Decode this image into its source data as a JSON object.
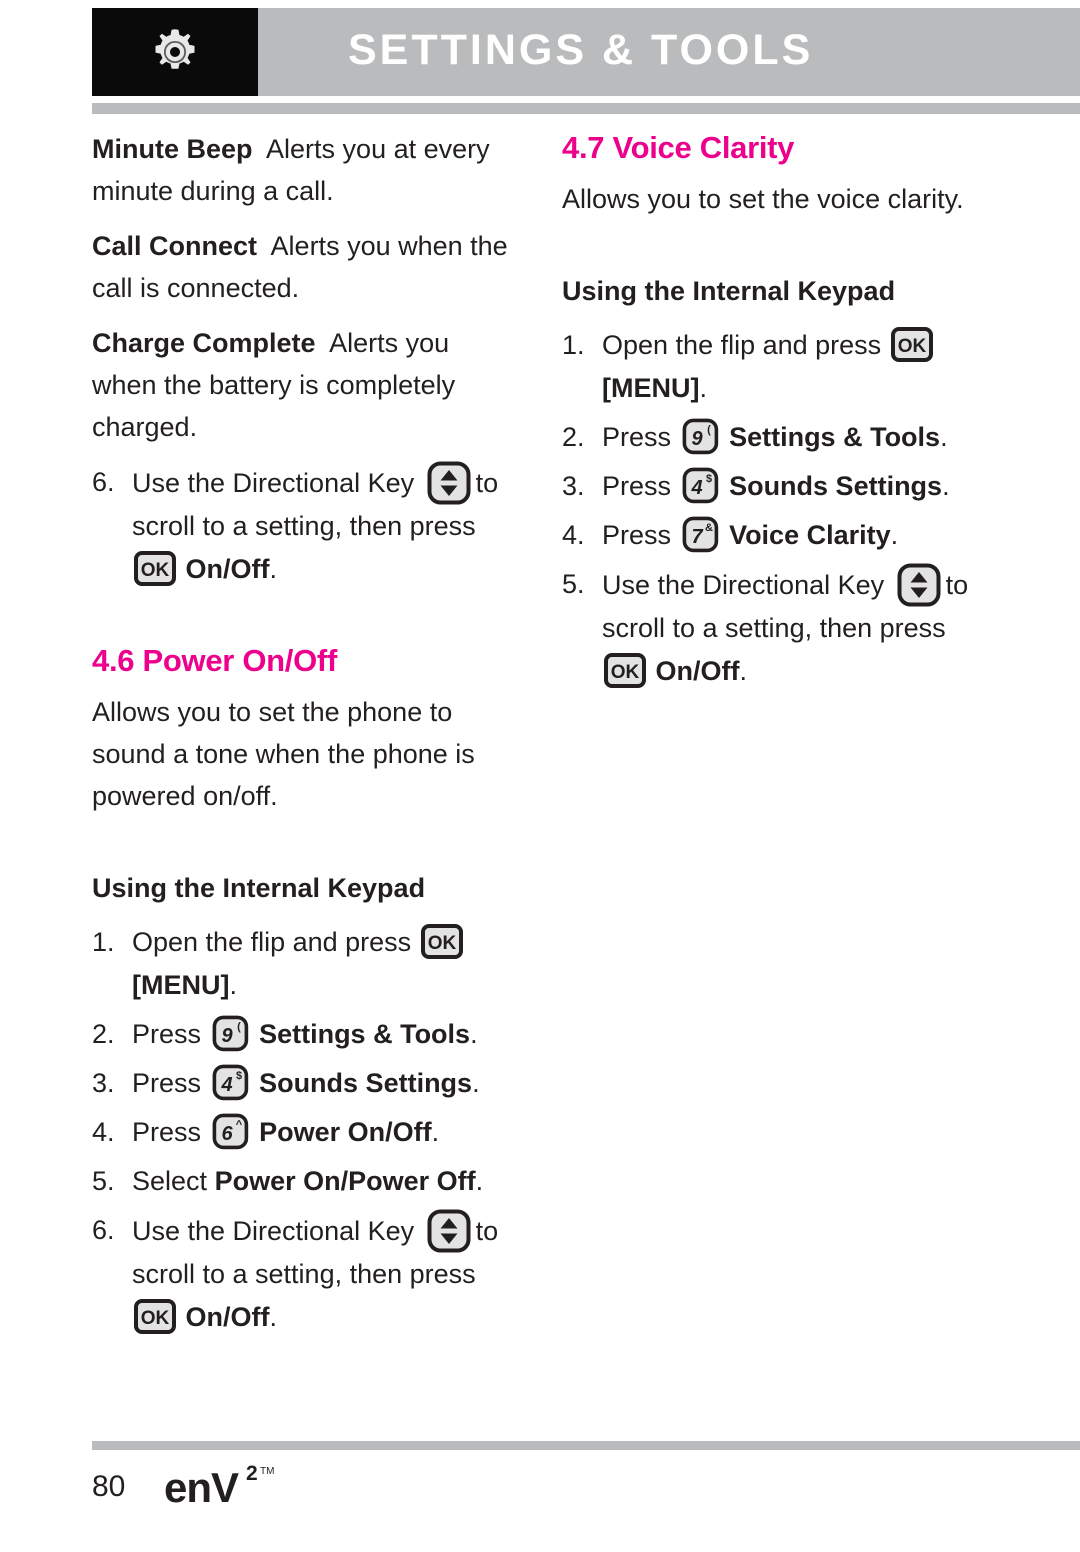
{
  "header": {
    "title": "SETTINGS & TOOLS",
    "icon": "gear-icon",
    "bar_color": "#b9bbbd",
    "icon_box_color": "#0a0a0a",
    "title_color": "#ffffff"
  },
  "theme": {
    "accent_pink": "#ec008c",
    "body_text": "#231f20",
    "rule_gray": "#b9bbbd"
  },
  "left_column": {
    "definitions": [
      {
        "term": "Minute Beep",
        "desc": "Alerts you at every minute during a call."
      },
      {
        "term": "Call Connect",
        "desc": "Alerts you when the call is connected."
      },
      {
        "term": "Charge Complete",
        "desc": "Alerts you when the battery is completely charged."
      }
    ],
    "trailing_step": {
      "num": "6.",
      "text_a": "Use the Directional Key",
      "key_directional": "directional-key",
      "text_b": "to scroll to a setting, then press",
      "key_ok": "OK",
      "bold_tail": "On/Off",
      "period": "."
    },
    "section": {
      "heading": "4.6 Power On/Off",
      "intro": "Allows you to set the phone to sound a tone when the phone is powered on/off.",
      "subheading": "Using the Internal Keypad",
      "steps": [
        {
          "num": "1.",
          "text_a": "Open the flip and press",
          "key_ok": "OK",
          "bold_tail": "[MENU]",
          "period": "."
        },
        {
          "num": "2.",
          "text_a": "Press",
          "key_digit": "9",
          "key_sup": "(",
          "bold_tail": "Settings & Tools",
          "period": "."
        },
        {
          "num": "3.",
          "text_a": "Press",
          "key_digit": "4",
          "key_sup": "$",
          "bold_tail": "Sounds Settings",
          "period": "."
        },
        {
          "num": "4.",
          "text_a": "Press",
          "key_digit": "6",
          "key_sup": "^",
          "bold_tail": "Power On/Off",
          "period": "."
        },
        {
          "num": "5.",
          "text_a": "Select",
          "bold_tail": "Power On/Power Off",
          "period": "."
        },
        {
          "num": "6.",
          "text_a": "Use the Directional Key",
          "key_directional": "directional-key",
          "text_b": "to scroll to a setting, then press",
          "key_ok": "OK",
          "bold_tail": "On/Off",
          "period": "."
        }
      ]
    }
  },
  "right_column": {
    "section": {
      "heading": "4.7 Voice Clarity",
      "intro": "Allows you to set the voice clarity.",
      "subheading": "Using the Internal Keypad",
      "steps": [
        {
          "num": "1.",
          "text_a": "Open the flip and press",
          "key_ok": "OK",
          "bold_tail": "[MENU]",
          "period": "."
        },
        {
          "num": "2.",
          "text_a": "Press",
          "key_digit": "9",
          "key_sup": "(",
          "bold_tail": "Settings & Tools",
          "period": "."
        },
        {
          "num": "3.",
          "text_a": "Press",
          "key_digit": "4",
          "key_sup": "$",
          "bold_tail": "Sounds Settings",
          "period": "."
        },
        {
          "num": "4.",
          "text_a": "Press",
          "key_digit": "7",
          "key_sup": "&",
          "bold_tail": "Voice Clarity",
          "period": "."
        },
        {
          "num": "5.",
          "text_a": "Use the Directional Key",
          "key_directional": "directional-key",
          "text_b": "to scroll to a setting, then press",
          "key_ok": "OK",
          "bold_tail": "On/Off",
          "period": "."
        }
      ]
    }
  },
  "footer": {
    "page_number": "80",
    "brand": "enV",
    "brand_sup": "2",
    "brand_tm": "TM"
  }
}
